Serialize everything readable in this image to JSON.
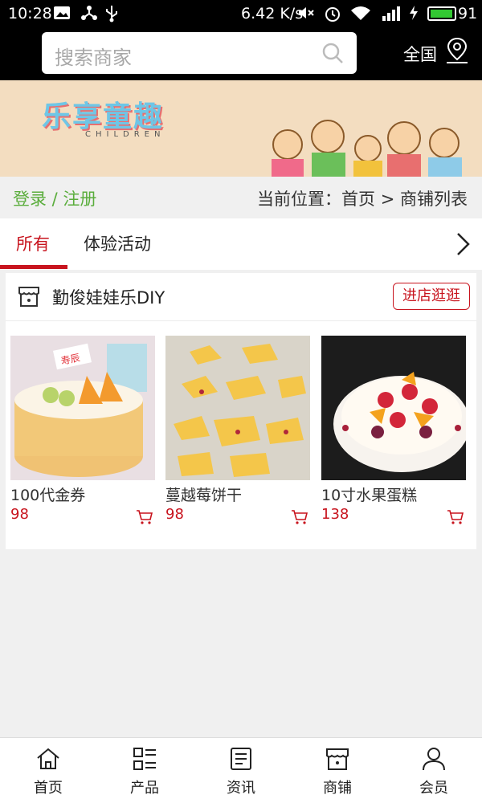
{
  "status_bar": {
    "time": "10:28",
    "speed": "6.42 K/s",
    "battery": "91",
    "battery_level": 0.91,
    "icons": [
      "image-icon",
      "share-icon",
      "usb-icon",
      "mute-icon",
      "alarm-icon",
      "wifi-icon",
      "signal-4g-icon",
      "charging-icon",
      "battery-icon"
    ]
  },
  "header": {
    "search_placeholder": "搜索商家",
    "region_label": "全国"
  },
  "banner": {
    "title": "乐享童趣",
    "subtitle": "CHILDREN"
  },
  "breadcrumb": {
    "auth_text": "登录 / 注册",
    "location_text": "当前位置：首页 > 商铺列表"
  },
  "tabs": [
    {
      "label": "所有",
      "active": true
    },
    {
      "label": "体验活动",
      "active": false
    }
  ],
  "shop": {
    "name": "勤俊娃娃乐DIY",
    "visit_label": "进店逛逛",
    "products": [
      {
        "name": "100代金券",
        "price": "98"
      },
      {
        "name": "蔓越莓饼干",
        "price": "98"
      },
      {
        "name": "10寸水果蛋糕",
        "price": "138"
      }
    ]
  },
  "nav": [
    {
      "label": "首页",
      "icon": "home-icon"
    },
    {
      "label": "产品",
      "icon": "grid-list-icon"
    },
    {
      "label": "资讯",
      "icon": "news-icon"
    },
    {
      "label": "商铺",
      "icon": "store-icon"
    },
    {
      "label": "会员",
      "icon": "user-icon"
    }
  ],
  "colors": {
    "accent": "#c8141e",
    "green": "#5aad3c",
    "header_bg": "#000000",
    "page_bg": "#f0f0f0"
  }
}
